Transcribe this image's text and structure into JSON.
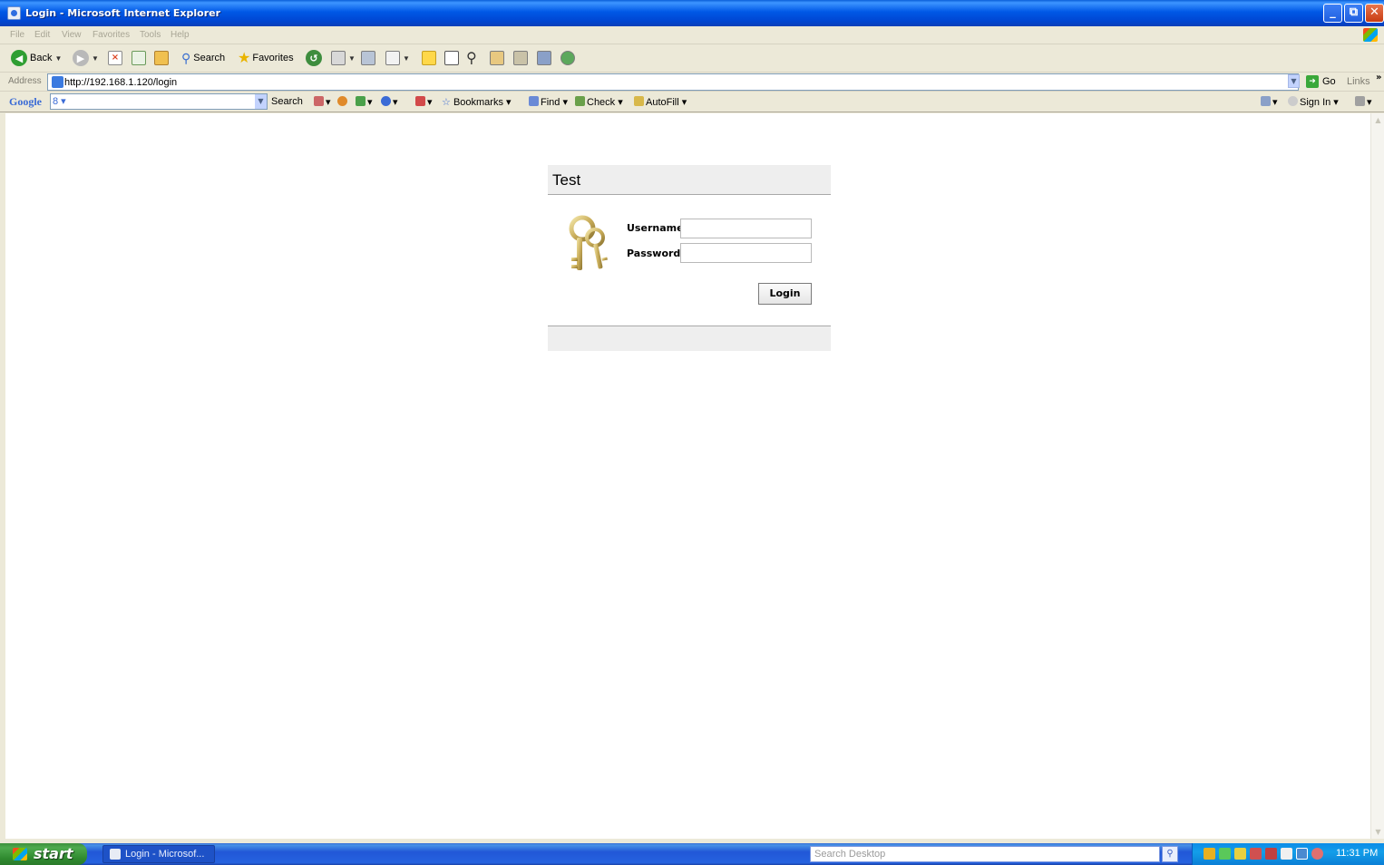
{
  "window": {
    "title": "Login - Microsoft Internet Explorer"
  },
  "menu": [
    "File",
    "Edit",
    "View",
    "Favorites",
    "Tools",
    "Help"
  ],
  "toolbar": {
    "back_label": "Back",
    "search_label": "Search",
    "favorites_label": "Favorites"
  },
  "address": {
    "label": "Address",
    "url": "http://192.168.1.120/login",
    "go_label": "Go",
    "links_label": "Links"
  },
  "google": {
    "logo": "Google",
    "field_prefix": "8 ▾",
    "search_label": "Search",
    "bookmarks_label": "Bookmarks",
    "find_label": "Find",
    "check_label": "Check",
    "autofill_label": "AutoFill",
    "signin_label": "Sign In"
  },
  "login": {
    "title": "Test",
    "username_label": "Username:",
    "password_label": "Password:",
    "username_value": "",
    "password_value": "",
    "button_label": "Login"
  },
  "taskbar": {
    "start_label": "start",
    "task_label": "Login - Microsof...",
    "search_placeholder": "Search Desktop",
    "clock": "11:31 PM"
  }
}
